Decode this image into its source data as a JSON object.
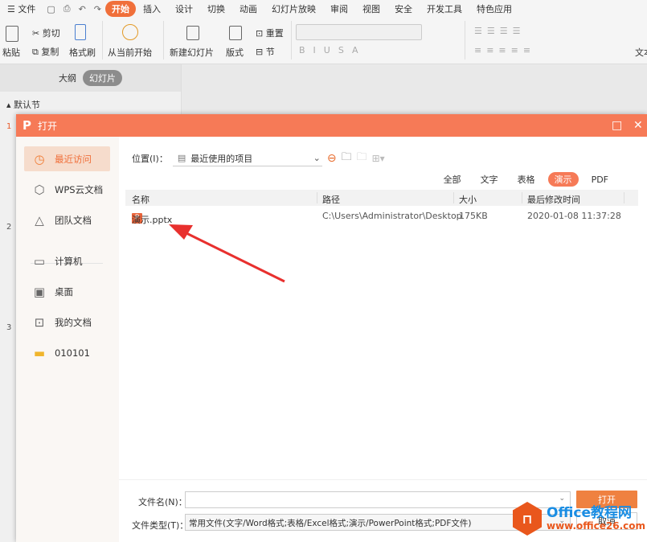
{
  "menubar": {
    "file": "☰ 文件",
    "tabs": [
      "开始",
      "插入",
      "设计",
      "切换",
      "动画",
      "幻灯片放映",
      "审阅",
      "视图",
      "安全",
      "开发工具",
      "特色应用"
    ],
    "active_tab": "开始"
  },
  "ribbon": {
    "paste": "粘贴",
    "cut": "剪切",
    "copy": "复制",
    "format_painter": "格式刷",
    "play_from_current": "从当前开始",
    "new_slide": "新建幻灯片",
    "layout": "版式",
    "reset": "重置",
    "section": "节",
    "text": "文本"
  },
  "left_panel": {
    "tabs": [
      "大纲",
      "幻灯片"
    ],
    "section": "默认节",
    "slide_numbers": [
      "1",
      "2",
      "3"
    ]
  },
  "dialog": {
    "title": "打开",
    "sidebar": [
      "最近访问",
      "WPS云文档",
      "团队文档",
      "计算机",
      "桌面",
      "我的文档",
      "010101"
    ],
    "location_label": "位置(I)：",
    "location_value": "最近使用的项目",
    "filters": [
      "全部",
      "文字",
      "表格",
      "演示",
      "PDF"
    ],
    "active_filter": "演示",
    "columns": [
      "名称",
      "路径",
      "大小",
      "最后修改时间"
    ],
    "files": [
      {
        "name": "演示.pptx",
        "path": "C:\\Users\\Administrator\\Desktop",
        "size": "175KB",
        "modified": "2020-01-08 11:37:28"
      }
    ],
    "filename_label": "文件名(N)：",
    "filename_value": "",
    "filetype_label": "文件类型(T)：",
    "filetype_value": "常用文件(文字/Word格式;表格/Excel格式;演示/PowerPoint格式;PDF文件)",
    "open_button": "打开",
    "cancel_button": "取消"
  },
  "watermark": {
    "line1": "Office教程网",
    "line2": "www.office26.com"
  },
  "colors": {
    "accent": "#f67a57",
    "button": "#ef8140",
    "arrow": "#e8302e"
  }
}
